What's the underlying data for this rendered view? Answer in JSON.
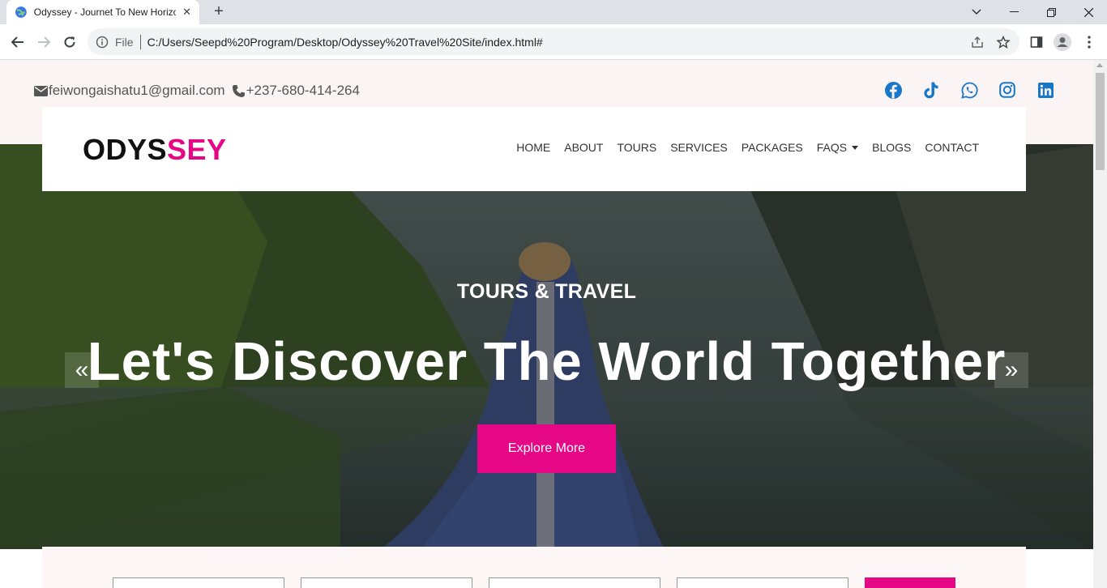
{
  "browser": {
    "tab_title": "Odyssey - Journet To New Horizons",
    "address_scheme": "File",
    "address_url": "C:/Users/Seepd%20Program/Desktop/Odyssey%20Travel%20Site/index.html#"
  },
  "topbar": {
    "email": "feiwongaishatu1@gmail.com",
    "phone": "+237-680-414-264",
    "socials": [
      "facebook",
      "tiktok",
      "whatsapp",
      "instagram",
      "linkedin"
    ]
  },
  "navbar": {
    "logo_part1": "ODYS",
    "logo_part2": "SEY",
    "menu": [
      {
        "label": "HOME"
      },
      {
        "label": "ABOUT"
      },
      {
        "label": "TOURS"
      },
      {
        "label": "SERVICES"
      },
      {
        "label": "PACKAGES"
      },
      {
        "label": "FAQS",
        "dropdown": true
      },
      {
        "label": "BLOGS"
      },
      {
        "label": "CONTACT"
      }
    ]
  },
  "hero": {
    "subtitle": "TOURS & TRAVEL",
    "title": "Let's Discover The World Together",
    "cta": "Explore More",
    "prev_icon": "«",
    "next_icon": "»"
  },
  "colors": {
    "accent": "#e60787",
    "topbar_bg": "#fbf4f4",
    "social_icon": "#1877c9"
  }
}
